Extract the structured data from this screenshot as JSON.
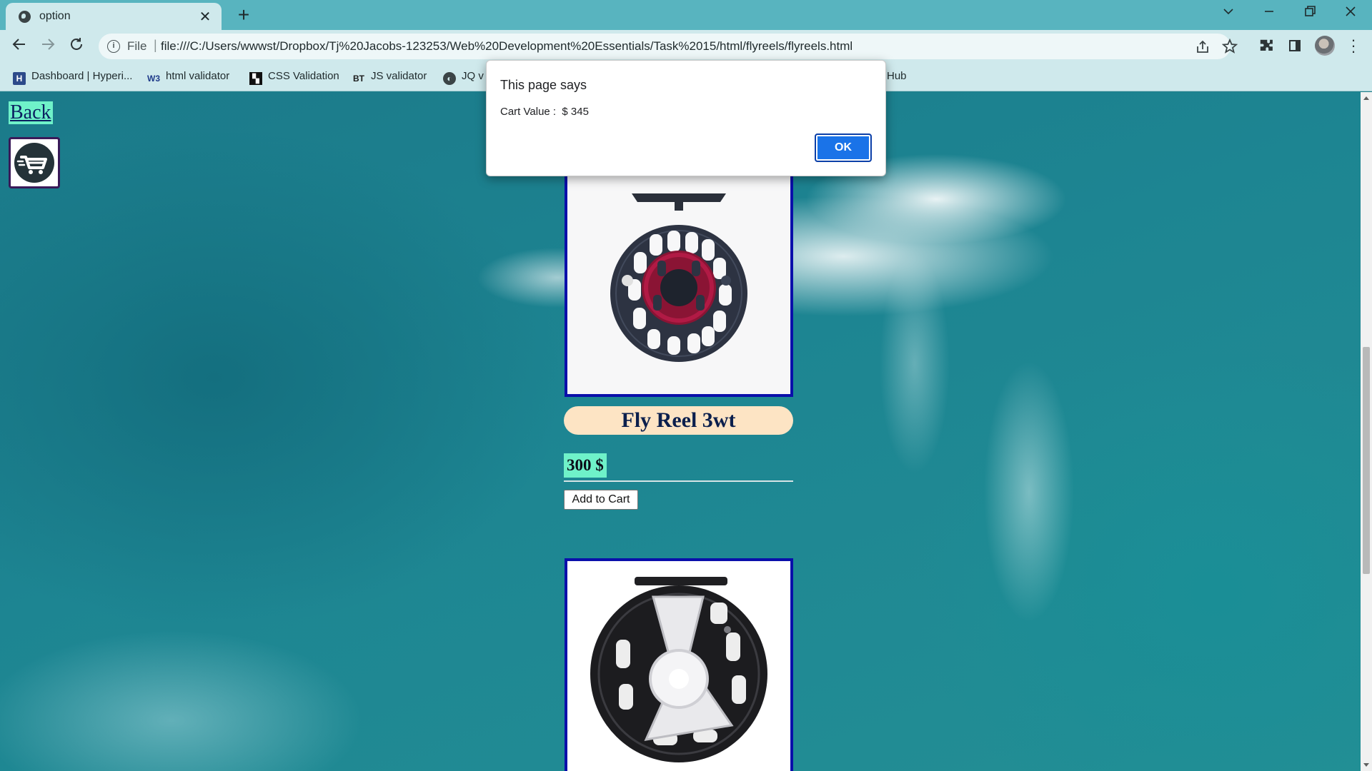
{
  "browser": {
    "tab_title": "option",
    "tab_close": "✕",
    "new_tab": "+",
    "address": {
      "scheme_label": "File",
      "separator": "|",
      "url": "file:///C:/Users/wwwst/Dropbox/Tj%20Jacobs-123253/Web%20Development%20Essentials/Task%2015/html/flyreels/flyreels.html"
    },
    "bookmarks": [
      {
        "label": "Dashboard | Hyperi...",
        "icon": "hyperion-icon"
      },
      {
        "label": "html validator",
        "icon": "w3c-icon"
      },
      {
        "label": "CSS Validation",
        "icon": "css-validator-icon"
      },
      {
        "label": "JS validator",
        "icon": "bt-icon"
      },
      {
        "label": "JQ v",
        "icon": "globe-icon"
      },
      {
        "label": "Hub",
        "icon": ""
      }
    ]
  },
  "page": {
    "back_label": "Back",
    "cart_icon": "shopping-cart-icon",
    "product": {
      "name": "Fly Reel 3wt",
      "price": "300 $",
      "add_to_cart_label": "Add to Cart"
    }
  },
  "dialog": {
    "title": "This page says",
    "message": "Cart Value :  $ 345",
    "ok_label": "OK"
  },
  "colors": {
    "accent_mint": "#6ff2c9",
    "name_pill": "#fde4c4",
    "image_border": "#0a0faa",
    "ok_button": "#1a73e8",
    "chrome_tabstrip": "#58b4bf",
    "chrome_toolbar": "#cfe9ec"
  }
}
